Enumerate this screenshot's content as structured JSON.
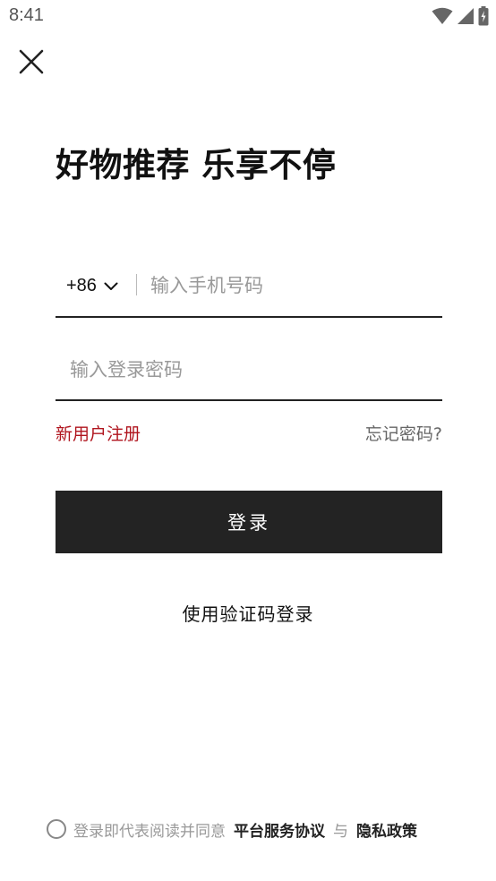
{
  "status_bar": {
    "time": "8:41",
    "icons": [
      "wifi-icon",
      "cellular-signal-icon",
      "battery-charging-icon"
    ]
  },
  "header": {
    "close_icon": "close-icon"
  },
  "headline": "好物推荐 乐享不停",
  "form": {
    "country_code": "+86",
    "phone_placeholder": "输入手机号码",
    "password_placeholder": "输入登录密码",
    "register_label": "新用户注册",
    "forgot_label": "忘记密码?",
    "login_label": "登录",
    "sms_login_label": "使用验证码登录"
  },
  "agreement": {
    "prefix": "登录即代表阅读并同意",
    "terms_label": "平台服务协议",
    "and_text": "与",
    "privacy_label": "隐私政策",
    "checked": false
  },
  "colors": {
    "accent_red": "#b0151e",
    "button_bg": "#232323",
    "text_primary": "#111111",
    "text_muted": "#999999"
  }
}
